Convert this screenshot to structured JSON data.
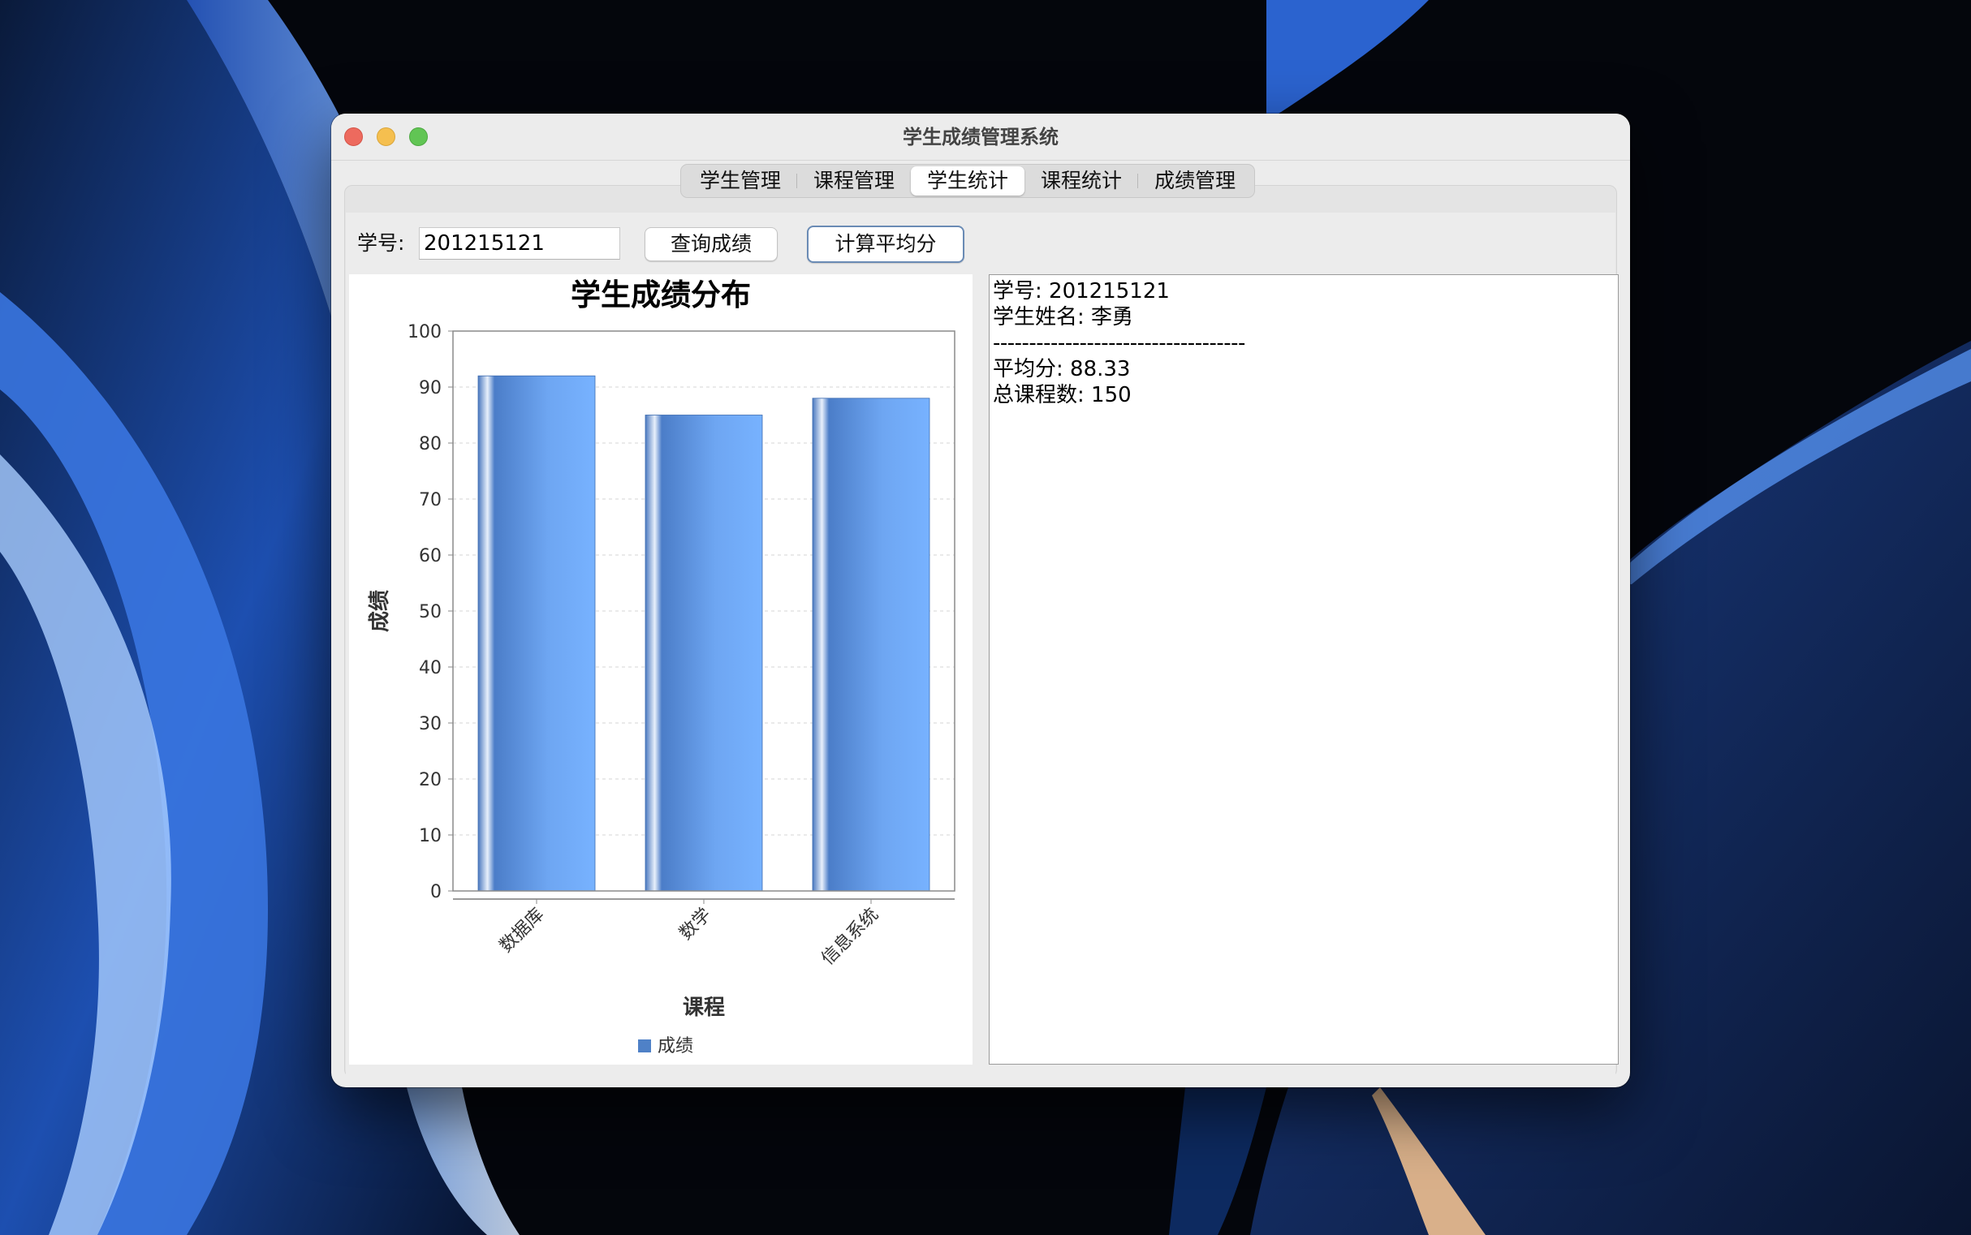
{
  "window": {
    "title": "学生成绩管理系统"
  },
  "tabs": [
    {
      "label": "学生管理",
      "selected": false
    },
    {
      "label": "课程管理",
      "selected": false
    },
    {
      "label": "学生统计",
      "selected": true
    },
    {
      "label": "课程统计",
      "selected": false
    },
    {
      "label": "成绩管理",
      "selected": false
    }
  ],
  "query": {
    "id_label": "学号:",
    "id_value": "201215121",
    "query_button": "查询成绩",
    "average_button": "计算平均分"
  },
  "chart_data": {
    "type": "bar",
    "title": "学生成绩分布",
    "xlabel": "课程",
    "ylabel": "成绩",
    "categories": [
      "数据库",
      "数学",
      "信息系统"
    ],
    "series": [
      {
        "name": "成绩",
        "values": [
          92,
          85,
          88
        ],
        "color": "#4f81c7"
      }
    ],
    "ylim": [
      0,
      100
    ],
    "yticks": [
      0,
      10,
      20,
      30,
      40,
      50,
      60,
      70,
      80,
      90,
      100
    ],
    "grid": true,
    "legend": "bottom"
  },
  "result": {
    "line1": "学号: 201215121",
    "line2": "学生姓名: 李勇",
    "line3": "-----------------------------------",
    "line4": "平均分: 88.33",
    "line5": "总课程数: 150"
  }
}
